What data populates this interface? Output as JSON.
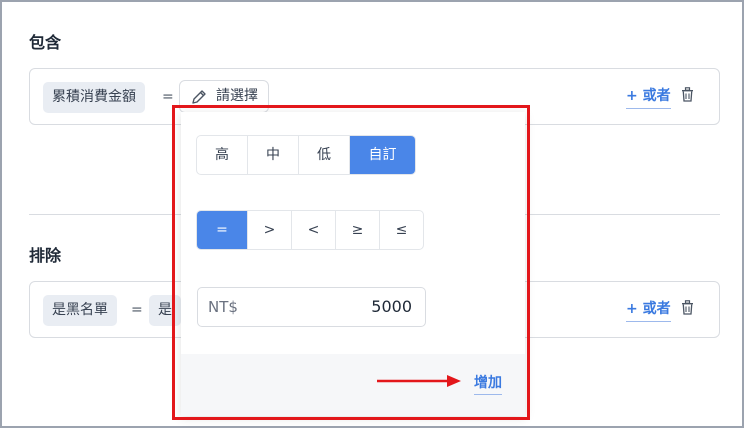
{
  "include": {
    "title": "包含",
    "field": "累積消費金額",
    "operator": "=",
    "select_label": "請選擇",
    "or_label": "+ 或者"
  },
  "exclude": {
    "title": "排除",
    "field": "是黑名單",
    "operator": "=",
    "value_partial": "是",
    "or_label": "+ 或者"
  },
  "popover": {
    "levels": [
      {
        "label": "高",
        "active": false
      },
      {
        "label": "中",
        "active": false
      },
      {
        "label": "低",
        "active": false
      },
      {
        "label": "自訂",
        "active": true
      }
    ],
    "operators": [
      {
        "label": "=",
        "active": true
      },
      {
        "label": ">",
        "active": false
      },
      {
        "label": "<",
        "active": false
      },
      {
        "label": "≥",
        "active": false
      },
      {
        "label": "≤",
        "active": false
      }
    ],
    "amount": {
      "prefix": "NT$",
      "value": "5000"
    },
    "add_label": "增加"
  },
  "colors": {
    "accent": "#4a86e8",
    "link": "#3b7ae0",
    "highlight": "#e3171b"
  },
  "icons": {
    "edit": "pencil-icon",
    "delete": "trash-icon",
    "annotation": "arrow-right-icon"
  }
}
